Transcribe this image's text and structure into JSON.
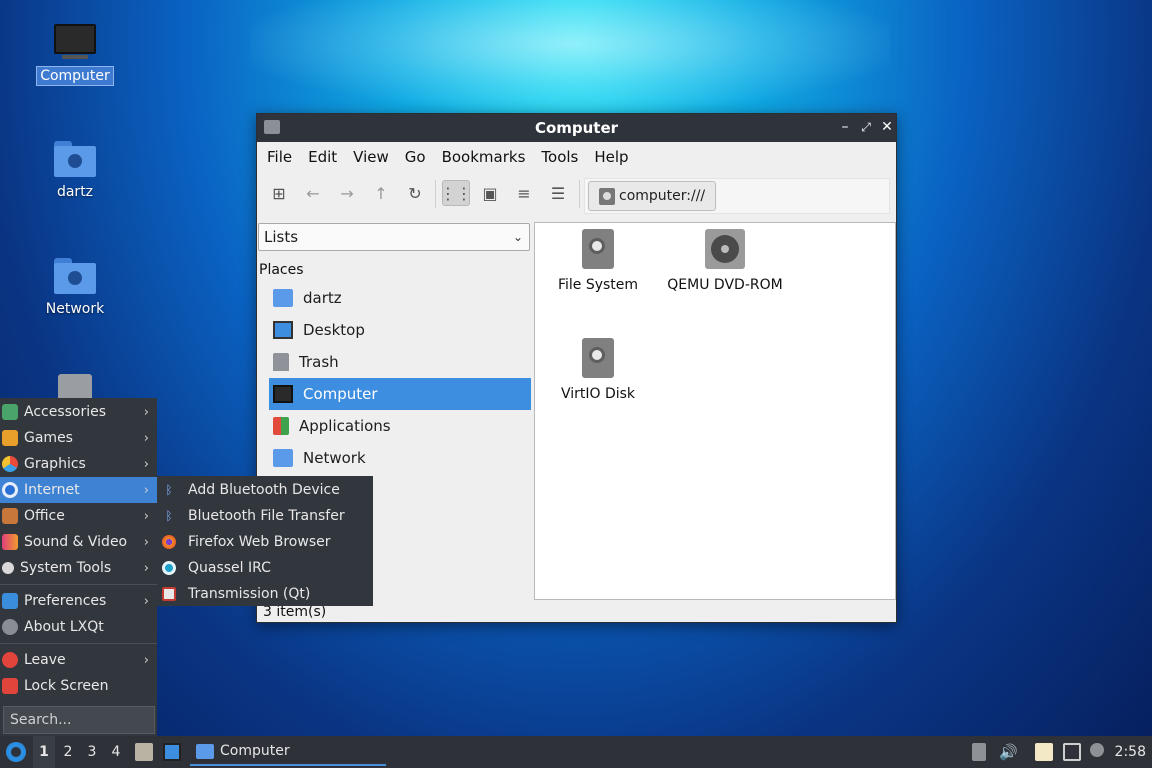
{
  "desktop": {
    "icons": [
      {
        "label": "Computer"
      },
      {
        "label": "dartz"
      },
      {
        "label": "Network"
      }
    ]
  },
  "window": {
    "title": "Computer",
    "menu": [
      "File",
      "Edit",
      "View",
      "Go",
      "Bookmarks",
      "Tools",
      "Help"
    ],
    "path": "computer:///",
    "sidebar": {
      "mode": "Lists",
      "places_header": "Places",
      "places": [
        "dartz",
        "Desktop",
        "Trash",
        "Computer",
        "Applications",
        "Network"
      ],
      "selected": "Computer"
    },
    "files": [
      {
        "name": "File System",
        "icon": "hard-disk-icon"
      },
      {
        "name": "QEMU DVD-ROM",
        "icon": "optical-drive-icon"
      },
      {
        "name": "VirtIO Disk",
        "icon": "hard-disk-icon"
      }
    ],
    "status": "3 item(s)"
  },
  "start_menu": {
    "items": [
      "Accessories",
      "Games",
      "Graphics",
      "Internet",
      "Office",
      "Sound & Video",
      "System Tools",
      "Preferences",
      "About LXQt",
      "Leave",
      "Lock Screen"
    ],
    "highlighted": "Internet",
    "search_placeholder": "Search..."
  },
  "submenu": {
    "items": [
      "Add Bluetooth Device",
      "Bluetooth File Transfer",
      "Firefox Web Browser",
      "Quassel IRC",
      "Transmission (Qt)"
    ]
  },
  "taskbar": {
    "workspaces": [
      "1",
      "2",
      "3",
      "4"
    ],
    "active_workspace": "1",
    "task_label": "Computer",
    "clock": "2:58"
  },
  "colors": {
    "selection": "#3d8ee0",
    "panel": "#32363d",
    "titlebar": "#2f343c"
  }
}
